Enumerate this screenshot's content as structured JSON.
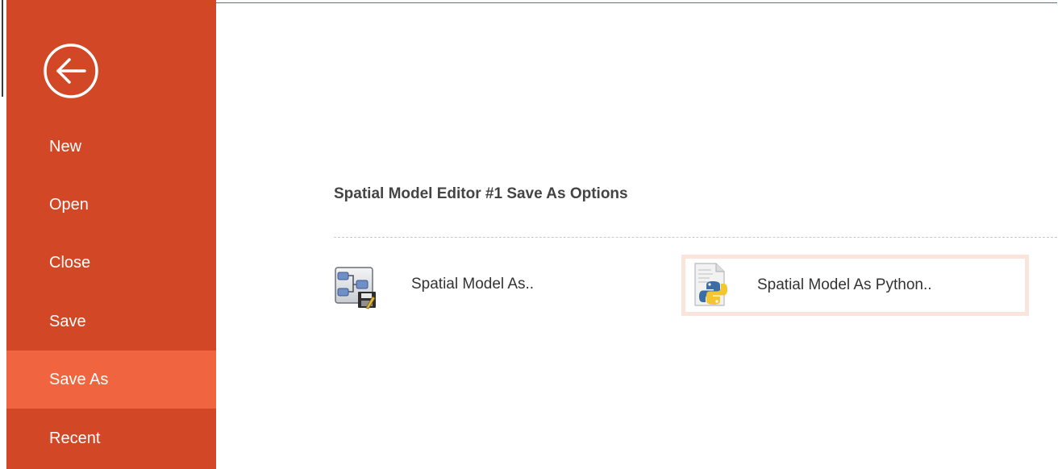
{
  "backstage": {
    "back_icon": "back-arrow-circle-icon",
    "accent_color": "#d24726",
    "active_color": "#f0643f",
    "nav_items": [
      {
        "label": "New",
        "active": false
      },
      {
        "label": "Open",
        "active": false
      },
      {
        "label": "Close",
        "active": false
      },
      {
        "label": "Save",
        "active": false
      },
      {
        "label": "Save As",
        "active": true
      },
      {
        "label": "Recent",
        "active": false
      }
    ]
  },
  "main": {
    "title": "Spatial Model Editor #1 Save As Options",
    "options": [
      {
        "label": "Spatial Model As..",
        "icon": "spatial-model-save-icon"
      },
      {
        "label": "Spatial Model As Python..",
        "icon": "python-file-icon",
        "highlighted": true
      }
    ]
  }
}
